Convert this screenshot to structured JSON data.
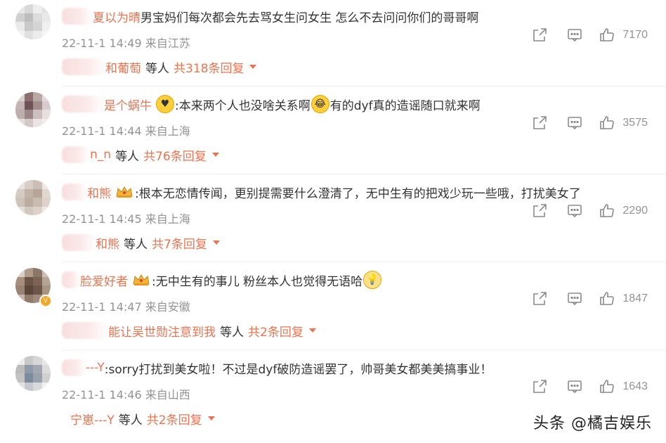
{
  "comments": [
    {
      "user": "夏以为晴",
      "text": "男宝妈们每次都会先去骂女生问女生 怎么不去问问你们的哥哥啊",
      "meta": "22-11-1 14:49 来自江苏",
      "likes": "7170",
      "reply_user": "和葡萄",
      "reply_mid": "等人",
      "reply_total": "共318条回复",
      "badge": "",
      "emoji_after_text": ""
    },
    {
      "user": "是个蜗牛",
      "text_a": ":本来两个人也没啥关系啊",
      "text_b": "有的dyf真的造谣随口就来啊",
      "meta": "22-11-1 14:44 来自上海",
      "likes": "3575",
      "reply_user": "n_n",
      "reply_mid": "等人",
      "reply_total": "共76条回复",
      "badge": "heart-face"
    },
    {
      "user": "和熊",
      "text": ":根本无恋情传闻，更别提需要什么澄清了，无中生有的把戏少玩一些哦，打扰美女了",
      "meta": "22-11-1 14:45 来自上海",
      "likes": "2290",
      "reply_user": "和熊",
      "reply_mid": "等人",
      "reply_total": "共7条回复",
      "badge": "crown"
    },
    {
      "user": "脸爱好者",
      "text": ":无中生有的事儿 粉丝本人也觉得无语哈",
      "meta": "22-11-1 14:47 来自安徽",
      "likes": "1847",
      "reply_user": "能让吴世勋注意到我",
      "reply_mid": "等人",
      "reply_total": "共2条回复",
      "badge": "crown"
    },
    {
      "user": "---Y",
      "text": ":sorry打扰到美女啦！不过是dyf破防造谣罢了，帅哥美女都美美搞事业！",
      "meta": "22-11-1 14:46 来自山西",
      "likes": "1643",
      "reply_user": "宁崽---Y",
      "reply_mid": "等人",
      "reply_total": "共2条回复",
      "badge": ""
    }
  ],
  "icons": {
    "share": "share-icon",
    "comment": "comment-icon",
    "like": "like-icon"
  },
  "watermark": "头条 @橘吉娱乐",
  "colors": {
    "accent": "#eb7350",
    "meta": "#939393",
    "text": "#333333"
  }
}
